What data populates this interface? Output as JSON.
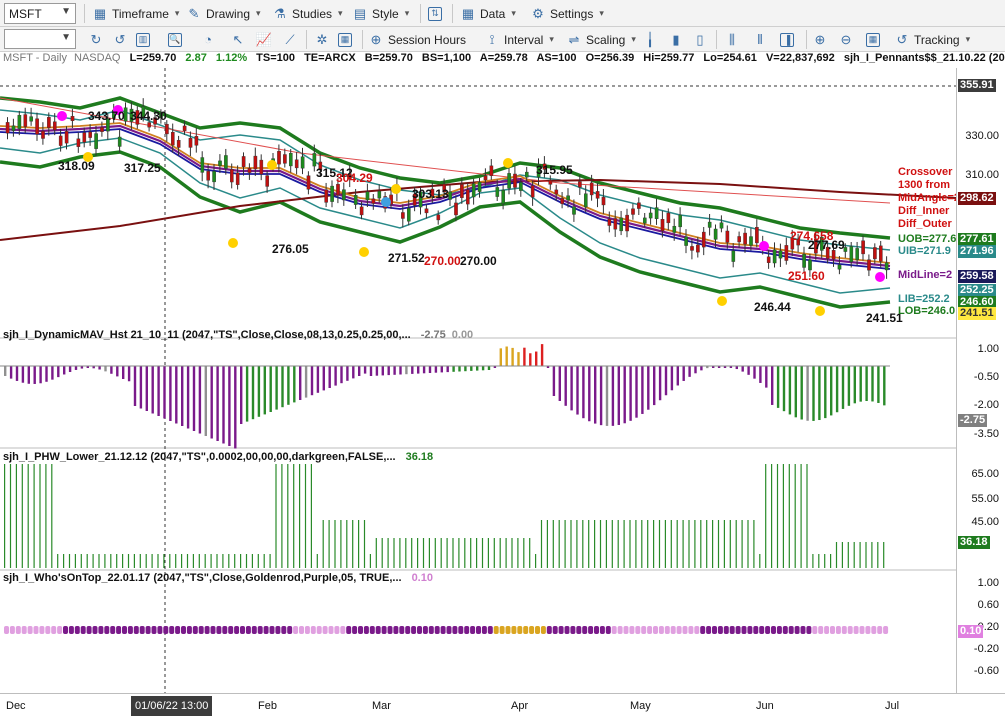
{
  "toolbar1": {
    "symbol": "MSFT",
    "timeframe": "Timeframe",
    "drawing": "Drawing",
    "studies": "Studies",
    "style": "Style",
    "data": "Data",
    "settings": "Settings"
  },
  "toolbar2": {
    "session_hours": "Session Hours",
    "interval": "Interval",
    "scaling": "Scaling",
    "tracking": "Tracking"
  },
  "status": {
    "instrument": "MSFT - Daily",
    "exchange": "NASDAQ",
    "last": "L=259.70",
    "change": "2.87",
    "pct": "1.12%",
    "ts": "TS=100",
    "te": "TE=ARCX",
    "bid": "B=259.70",
    "bs": "BS=1,100",
    "ask": "A=259.78",
    "as": "AS=100",
    "open": "O=256.39",
    "high": "Hi=259.77",
    "low": "Lo=254.61",
    "volume": "V=22,837,692",
    "study": "sjh_I_Pennants$$_21.10.22 (20..."
  },
  "price_pane": {
    "annotations": [
      "343.70",
      "344.30",
      "318.09",
      "317.25",
      "315.12",
      "304.29",
      "276.05",
      "303.13",
      "271.52",
      "270.00",
      "270.00",
      "315.95",
      "274.658",
      "277.69",
      "251.60",
      "246.44",
      "241.51"
    ],
    "right_labels": {
      "crossover": "Crossover",
      "from": "1300 from",
      "midangle": "MidAngle=200",
      "diff_inner": "Diff_Inner",
      "diff_outer": "Diff_Outer",
      "uob": "UOB=277.6",
      "uib": "UIB=271.9",
      "mid": "MidLine=2",
      "lib": "LIB=252.2",
      "lob": "LOB=246.0"
    },
    "axis_ticks": [
      "355.91",
      "330.00",
      "310.00",
      "298.62",
      "277.61",
      "271.96",
      "259.58",
      "252.25",
      "246.60",
      "241.51"
    ],
    "axis_plain": [
      "330.00",
      "310.00"
    ]
  },
  "pane2": {
    "title": "sjh_I_DynamicMAV_Hst 21_10_11 (2047,\"TS\",Close,Close,08,13,0.25,0.25,00,...",
    "value1": "-2.75",
    "value2": "0.00",
    "axis_ticks": [
      "1.00",
      "-0.50",
      "-2.00",
      "-2.75",
      "-3.50"
    ]
  },
  "pane3": {
    "title": "sjh_I_PHW_Lower_21.12.12 (2047,\"TS\",0.0002,00,00,00,darkgreen,FALSE,...",
    "value": "36.18",
    "axis_ticks": [
      "65.00",
      "55.00",
      "45.00",
      "36.18"
    ]
  },
  "pane4": {
    "title": "sjh_I_Who'sOnTop_22.01.17 (2047,\"TS\",Close,Goldenrod,Purple,05, TRUE,...",
    "value": "0.10",
    "axis_ticks": [
      "1.00",
      "0.60",
      "0.20",
      "0.10",
      "-0.20",
      "-0.60"
    ]
  },
  "dates": {
    "dec": "Dec",
    "crosshair": "01/06/22 13:00",
    "feb": "Feb",
    "mar": "Mar",
    "apr": "Apr",
    "may": "May",
    "jun": "Jun",
    "jul": "Jul"
  },
  "colors": {
    "green_band": "#1e7b1e",
    "teal_band": "#2a8a8a",
    "maroon_ma": "#7a1010",
    "orange_ma": "#d08020",
    "blue_ma": "#1a1aa0",
    "purple": "#7a1a8a",
    "goldenrod": "#daa520",
    "magenta": "#ff00ff",
    "yellow": "#ffd000",
    "hist_green": "#2a8a2a",
    "hist_purple": "#7a1a8a",
    "hist_gray": "#909090",
    "hist_red": "#dd2020",
    "hist_gold": "#daa520"
  }
}
